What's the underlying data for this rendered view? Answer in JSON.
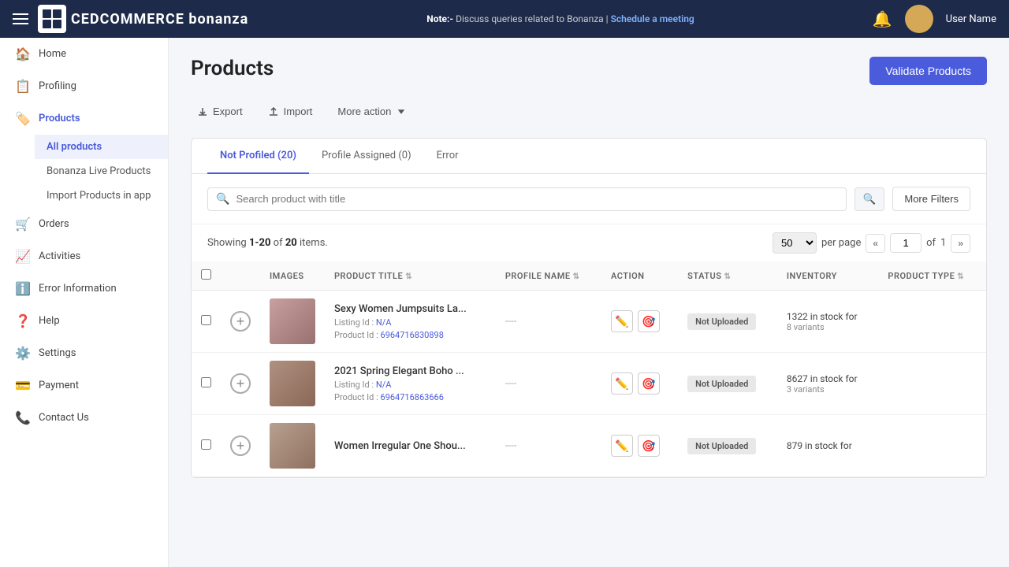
{
  "topbar": {
    "note": "Note:-",
    "note_text": " Discuss queries related to Bonanza | ",
    "meeting_link": "Schedule a meeting",
    "user_name": "User Name"
  },
  "sidebar": {
    "items": [
      {
        "id": "home",
        "label": "Home",
        "icon": "🏠",
        "active": false
      },
      {
        "id": "profiling",
        "label": "Profiling",
        "icon": "📋",
        "active": false
      },
      {
        "id": "products",
        "label": "Products",
        "icon": "🏷️",
        "active": true
      },
      {
        "id": "orders",
        "label": "Orders",
        "icon": "🛒",
        "active": false
      },
      {
        "id": "activities",
        "label": "Activities",
        "icon": "📈",
        "active": false
      },
      {
        "id": "error-information",
        "label": "Error Information",
        "icon": "ℹ️",
        "active": false
      },
      {
        "id": "help",
        "label": "Help",
        "icon": "❓",
        "active": false
      },
      {
        "id": "settings",
        "label": "Settings",
        "icon": "⚙️",
        "active": false
      },
      {
        "id": "payment",
        "label": "Payment",
        "icon": "💳",
        "active": false
      },
      {
        "id": "contact-us",
        "label": "Contact Us",
        "icon": "📞",
        "active": false
      }
    ],
    "sub_items": [
      {
        "id": "all-products",
        "label": "All products",
        "active": true
      },
      {
        "id": "bonanza-live",
        "label": "Bonanza Live Products",
        "active": false
      },
      {
        "id": "import-products",
        "label": "Import Products in app",
        "active": false
      }
    ]
  },
  "page": {
    "title": "Products",
    "validate_btn": "Validate Products"
  },
  "toolbar": {
    "export_label": "Export",
    "import_label": "Import",
    "more_action_label": "More action"
  },
  "tabs": [
    {
      "id": "not-profiled",
      "label": "Not Profiled (20)",
      "active": true
    },
    {
      "id": "profile-assigned",
      "label": "Profile Assigned (0)",
      "active": false
    },
    {
      "id": "error",
      "label": "Error",
      "active": false
    }
  ],
  "search": {
    "placeholder": "Search product with title"
  },
  "more_filters_label": "More Filters",
  "showing": {
    "prefix": "Showing ",
    "range": "1-20",
    "of_text": " of ",
    "total": "20",
    "suffix": " items."
  },
  "pagination": {
    "per_page": "50",
    "per_page_label": "per page",
    "current_page": "1",
    "total_pages": "1"
  },
  "table": {
    "columns": [
      "",
      "",
      "IMAGES",
      "PRODUCT TITLE",
      "PROFILE NAME",
      "ACTION",
      "STATUS",
      "INVENTORY",
      "PRODUCT TYPE"
    ],
    "rows": [
      {
        "id": 1,
        "image_url": "",
        "image_color": "#c8a0a0",
        "product_title": "Sexy Women Jumpsuits La...",
        "listing_id": "N/A",
        "product_id": "6964716830898",
        "profile_name": "----",
        "status": "Not Uploaded",
        "inventory": "1322 in stock for",
        "variants": "8 variants",
        "product_type": ""
      },
      {
        "id": 2,
        "image_url": "",
        "image_color": "#b0928a",
        "product_title": "2021 Spring Elegant Boho ...",
        "listing_id": "N/A",
        "product_id": "6964716863666",
        "profile_name": "----",
        "status": "Not Uploaded",
        "inventory": "8627 in stock for",
        "variants": "3 variants",
        "product_type": ""
      },
      {
        "id": 3,
        "image_url": "",
        "image_color": "#b8a090",
        "product_title": "Women Irregular One Shou...",
        "listing_id": "",
        "product_id": "",
        "profile_name": "----",
        "status": "Not Uploaded",
        "inventory": "879 in stock for",
        "variants": "",
        "product_type": ""
      }
    ]
  },
  "labels": {
    "listing_id": "Listing Id :",
    "product_id": "Product Id :"
  }
}
